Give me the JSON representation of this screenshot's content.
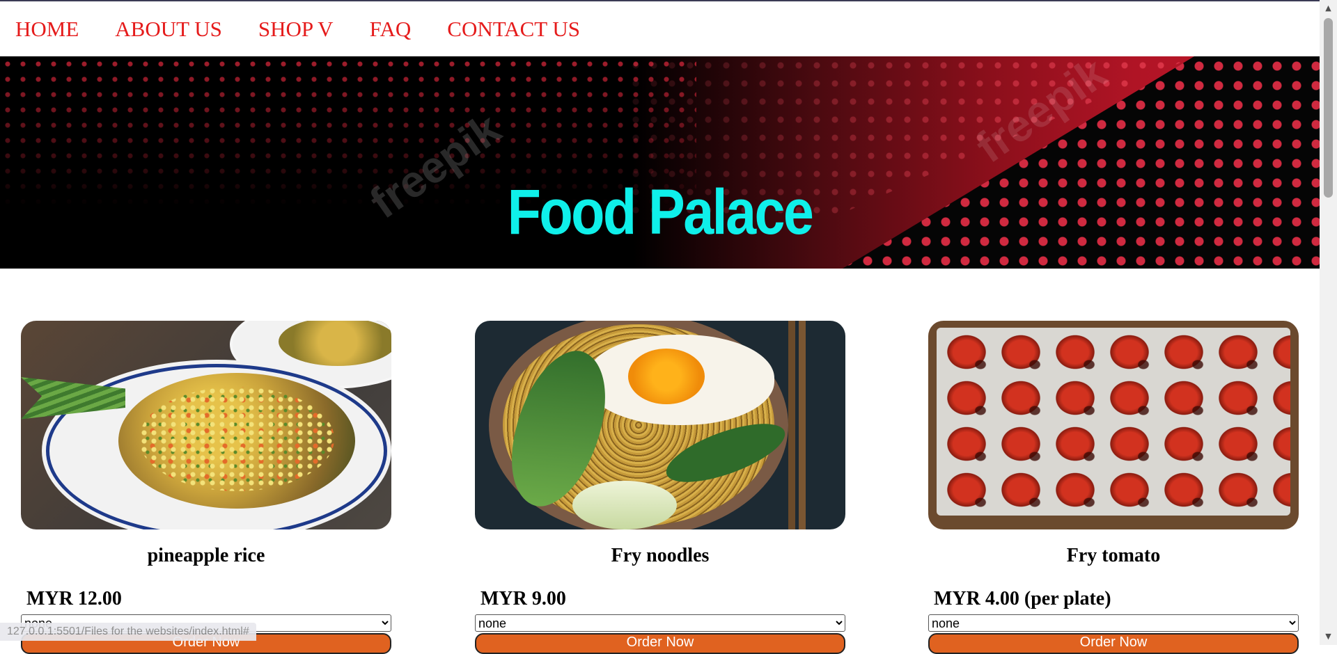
{
  "nav": {
    "items": [
      {
        "label": "HOME"
      },
      {
        "label": "ABOUT US"
      },
      {
        "label": "SHOP V"
      },
      {
        "label": "FAQ"
      },
      {
        "label": "CONTACT US"
      }
    ]
  },
  "banner": {
    "title": "Food Palace",
    "watermark": "freepik"
  },
  "products": [
    {
      "name": "pineapple rice",
      "price": "MYR 12.00",
      "select_value": "none",
      "button": "Order Now"
    },
    {
      "name": "Fry noodles",
      "price": "MYR 9.00",
      "select_value": "none",
      "button": "Order Now"
    },
    {
      "name": "Fry tomato",
      "price": "MYR 4.00 (per plate)",
      "select_value": "none",
      "button": "Order Now"
    }
  ],
  "status_bar": {
    "url": "127.0.0.1:5501/Files for the websites/index.html#"
  },
  "colors": {
    "nav_link": "#e51b1b",
    "banner_title": "#0ff0ea",
    "order_button": "#e06220"
  }
}
